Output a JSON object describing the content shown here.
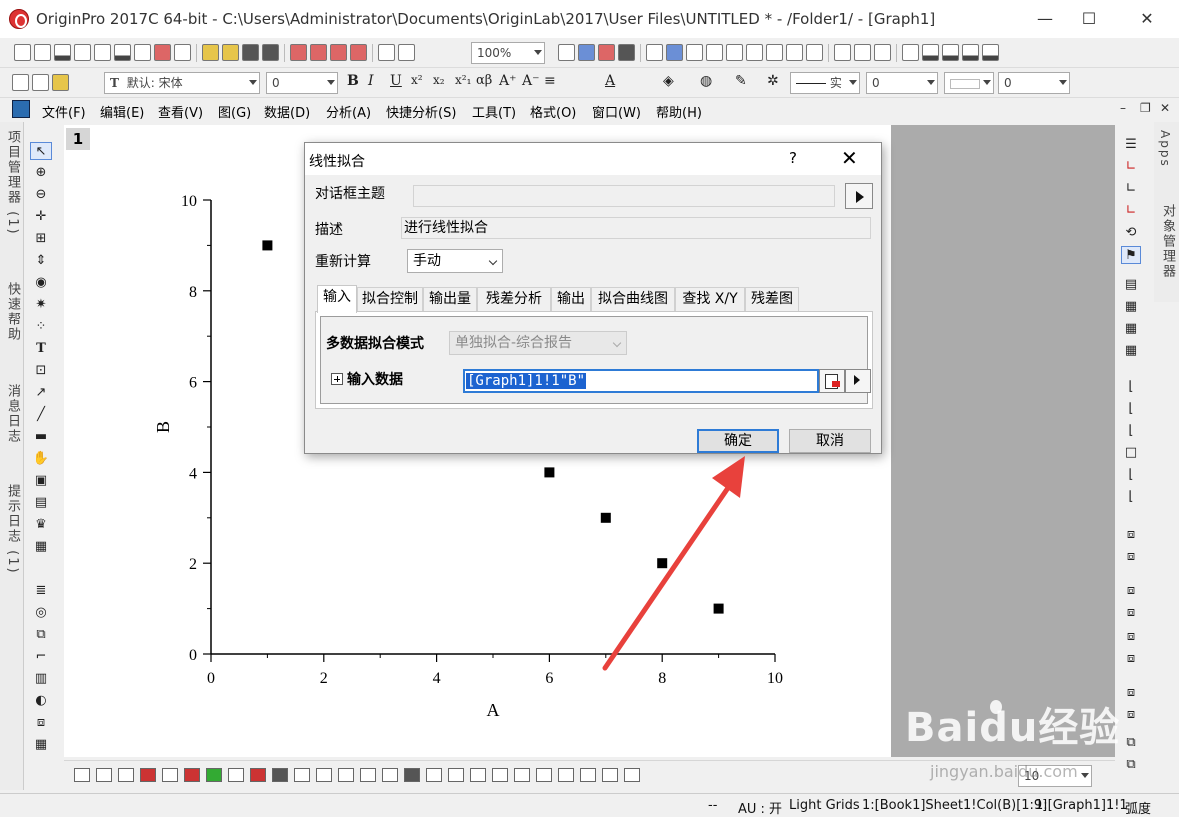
{
  "window": {
    "title": "OriginPro 2017C 64-bit - C:\\Users\\Administrator\\Documents\\OriginLab\\2017\\User Files\\UNTITLED * - /Folder1/ - [Graph1]",
    "minimize": "—",
    "maximize": "☐",
    "close": "✕"
  },
  "toolbar": {
    "zoom": "100%",
    "font": "默认: 宋体",
    "font_size": "0",
    "line_style": "实",
    "line_width": "0",
    "fill_pct": "0"
  },
  "menu": [
    "文件(F)",
    "编辑(E)",
    "查看(V)",
    "图(G)",
    "数据(D)",
    "分析(A)",
    "快捷分析(S)",
    "工具(T)",
    "格式(O)",
    "窗口(W)",
    "帮助(H)"
  ],
  "mdi_buttons": {
    "minimize": "–",
    "restore": "❐",
    "close": "✕"
  },
  "left_tabs": [
    "项目管理器 (1)",
    "快速帮助",
    "消息日志",
    "提示日志 (1)"
  ],
  "right_tabs": [
    "Apps",
    "对象管理器"
  ],
  "graph": {
    "layer": "1",
    "xlabel": "A",
    "ylabel": "B"
  },
  "chart_data": {
    "type": "scatter",
    "x": [
      1,
      6,
      7,
      8,
      9
    ],
    "y": [
      9,
      4,
      3,
      2,
      1
    ],
    "xlabel": "A",
    "ylabel": "B",
    "xlim": [
      0,
      10
    ],
    "ylim": [
      0,
      10
    ],
    "xticks": [
      0,
      2,
      4,
      6,
      8,
      10
    ],
    "yticks": [
      0,
      2,
      4,
      6,
      8,
      10
    ],
    "marker": "square",
    "marker_color": "#000000",
    "grid": false
  },
  "dialog": {
    "title": "线性拟合",
    "help": "?",
    "close": "✕",
    "theme_label": "对话框主题",
    "desc_label": "描述",
    "desc_value": "进行线性拟合",
    "recalc_label": "重新计算",
    "recalc_value": "手动",
    "tabs": [
      "输入",
      "拟合控制",
      "输出量",
      "残差分析",
      "输出",
      "拟合曲线图",
      "查找 X/Y",
      "残差图"
    ],
    "mode_label": "多数据拟合模式",
    "mode_value": "单独拟合-综合报告",
    "input_label": "输入数据",
    "input_value": "[Graph1]1!1\"B\"",
    "ok": "确定",
    "cancel": "取消"
  },
  "bottom_toolbar": {
    "value": "10"
  },
  "status": {
    "dash": "--",
    "au": "AU : 开",
    "theme": "Light Grids",
    "col": "1:[Book1]Sheet1!Col(B)[1:9]",
    "layer": "1:[Graph1]1!1",
    "unit": "弧度"
  },
  "watermark": {
    "brand": "Bai",
    "brand_cn": "du经验",
    "url": "jingyan.baidu.com"
  },
  "colors": {
    "accent": "#2e7bd6",
    "arrow": "#e8413c",
    "graph_bg": "#ffffff",
    "page_gray": "#ababab"
  }
}
